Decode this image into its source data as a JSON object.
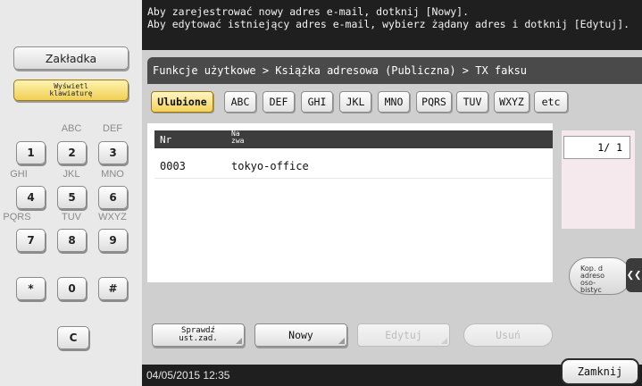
{
  "message": {
    "line1": "Aby zarejestrować nowy adres e-mail, dotknij [Nowy].",
    "line2": "Aby edytować istniejący adres e-mail, wybierz żądany adres i dotknij [Edytuj]."
  },
  "sidebar": {
    "bookmark_label": "Zakładka",
    "keyboard_label_line1": "Wyświetl",
    "keyboard_label_line2": "klawiaturę"
  },
  "keypad": {
    "labels": {
      "abc": "ABC",
      "def": "DEF",
      "ghi": "GHI",
      "jkl": "JKL",
      "mno": "MNO",
      "pqrs": "PQRS",
      "tuv": "TUV",
      "wxyz": "WXYZ"
    },
    "keys": [
      "1",
      "2",
      "3",
      "4",
      "5",
      "6",
      "7",
      "8",
      "9",
      "*",
      "0",
      "#"
    ],
    "clear": "C"
  },
  "breadcrumb": "Funkcje użytkowe > Książka adresowa (Publiczna) > TX faksu",
  "tabs": [
    "Ulubione",
    "ABC",
    "DEF",
    "GHI",
    "JKL",
    "MNO",
    "PQRS",
    "TUV",
    "WXYZ",
    "etc"
  ],
  "active_tab": "Ulubione",
  "table": {
    "col_nr": "Nr",
    "col_name_line1": "Na",
    "col_name_line2": "zwa",
    "rows": [
      {
        "nr": "0003",
        "name": "tokyo-office"
      }
    ]
  },
  "pager": "1/ 1",
  "copy_button": {
    "line1": "Kop. d",
    "line2": "adreso",
    "line3": "oso-",
    "line4": "bistyc"
  },
  "bottom": {
    "check_line1": "Sprawdź",
    "check_line2": "ust.zad.",
    "new": "Nowy",
    "edit": "Edytuj",
    "delete": "Usuń"
  },
  "status_datetime": "04/05/2015  12:35",
  "close_label": "Zamknij",
  "colors": {
    "accent_yellow": "#f3d25a",
    "dark_bar": "#1f1f1f",
    "panel_gray": "#cfcfcf"
  }
}
